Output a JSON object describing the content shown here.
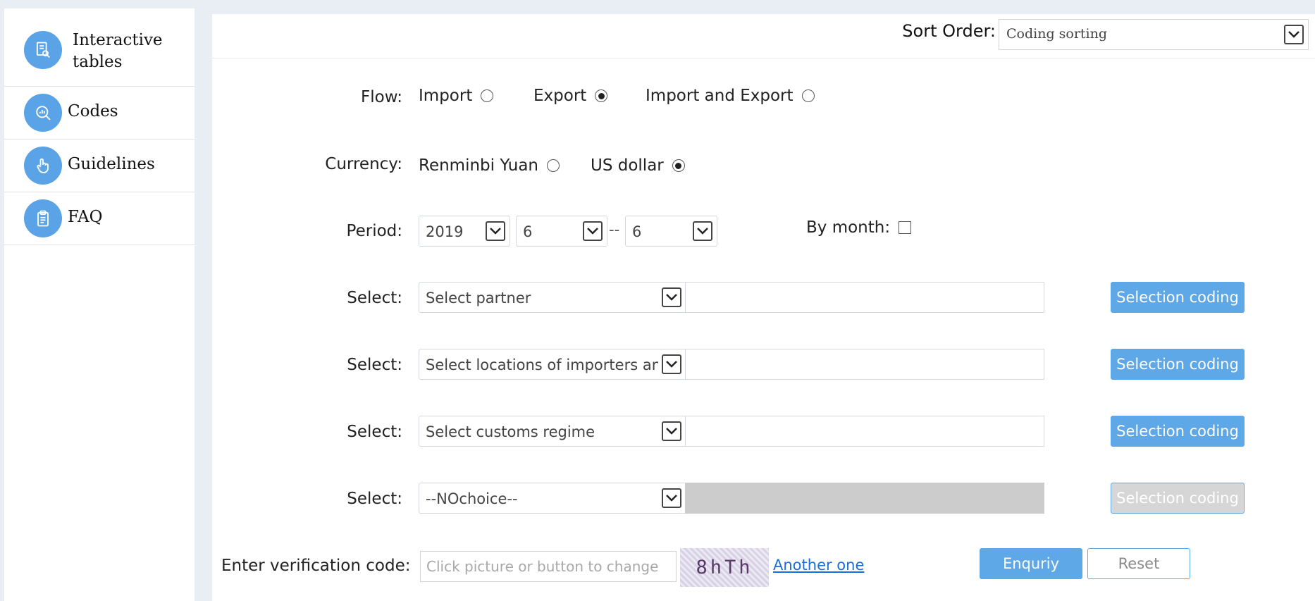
{
  "sidebar": {
    "items": [
      {
        "label_line1": "Interactive",
        "label_line2": "tables",
        "icon": "document-search-icon"
      },
      {
        "label": "Codes",
        "icon": "chart-search-icon"
      },
      {
        "label": "Guidelines",
        "icon": "hand-pointer-icon"
      },
      {
        "label": "FAQ",
        "icon": "clipboard-icon"
      }
    ]
  },
  "topbar": {
    "sort_label": "Sort Order:",
    "sort_value": "Coding sorting"
  },
  "form": {
    "flow": {
      "label": "Flow:",
      "options": [
        {
          "label": "Import",
          "selected": false
        },
        {
          "label": "Export",
          "selected": true
        },
        {
          "label": "Import and Export",
          "selected": false
        }
      ]
    },
    "currency": {
      "label": "Currency:",
      "options": [
        {
          "label": "Renminbi Yuan",
          "selected": false
        },
        {
          "label": "US dollar",
          "selected": true
        }
      ]
    },
    "period": {
      "label": "Period:",
      "year": "2019",
      "from_month": "6",
      "separator": "--",
      "to_month": "6",
      "by_month_label": "By month:",
      "by_month_checked": false
    },
    "selects": [
      {
        "label": "Select:",
        "value": "Select partner",
        "button": "Selection coding",
        "disabled": false
      },
      {
        "label": "Select:",
        "value": "Select locations of importers an",
        "button": "Selection coding",
        "disabled": false
      },
      {
        "label": "Select:",
        "value": "Select customs regime",
        "button": "Selection coding",
        "disabled": false
      },
      {
        "label": "Select:",
        "value": "--NOchoice--",
        "button": "Selection coding",
        "disabled": true
      }
    ],
    "verification": {
      "label": "Enter verification code:",
      "placeholder": "Click picture or button to change",
      "captcha_text": "8hTh",
      "another_link": "Another one"
    },
    "enquiry_button": "Enquriy",
    "reset_button": "Reset"
  },
  "colors": {
    "accent": "#5fa8e8",
    "icon_bg": "#5aa3e6",
    "link": "#1a6fd6",
    "disabled": "#cccccc"
  }
}
